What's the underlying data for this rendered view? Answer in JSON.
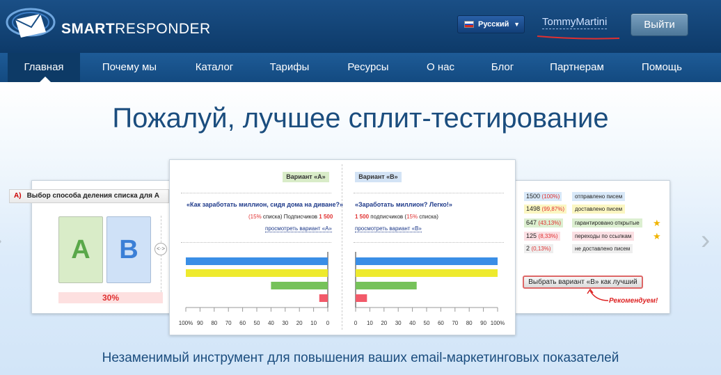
{
  "brand": {
    "logo_bold": "SMART",
    "logo_rest": "RESPONDER"
  },
  "header": {
    "language": "Русский",
    "language_flag": "flag-russia-icon",
    "username": "TommyMartini",
    "logout_label": "Выйти"
  },
  "nav": {
    "items": [
      {
        "label": "Главная"
      },
      {
        "label": "Почему мы"
      },
      {
        "label": "Каталог"
      },
      {
        "label": "Тарифы"
      },
      {
        "label": "Ресурсы"
      },
      {
        "label": "О нас"
      },
      {
        "label": "Блог"
      },
      {
        "label": "Партнерам"
      },
      {
        "label": "Помощь"
      }
    ]
  },
  "hero": {
    "title": "Пожалуй, лучшее сплит-тестирование",
    "subtitle": "Незаменимый инструмент для повышения ваших email-маркетинговых показателей"
  },
  "left_panel": {
    "marker": "A)",
    "heading": "Выбор способа деления списка для А",
    "box_a": "A",
    "box_b": "B",
    "swap": "<·>",
    "percent": "30%"
  },
  "center_panel": {
    "variant_a": "Вариант «А»",
    "variant_b": "Вариант «В»",
    "subject_a": "«Как заработать миллион, сидя дома на диване?»",
    "subject_b": "«Заработать миллион? Легко!»",
    "info_a_pct": "(15%",
    "info_a_mid": " списка) Подписчиков ",
    "info_a_num": "1 500",
    "info_b_num": "1 500",
    "info_b_mid": " подписчиков (",
    "info_b_pct": "15%",
    "info_b_end": " списка)",
    "link_a": "просмотреть вариант «А»",
    "link_b": "просмотреть вариант «В»"
  },
  "chart_data": {
    "type": "bar",
    "orientation": "horizontal",
    "colors": [
      "#3a8ee6",
      "#eeea2e",
      "#76c25a",
      "#f25a6a"
    ],
    "series": [
      {
        "values": [
          100,
          100,
          40,
          6
        ]
      },
      {
        "values": [
          100,
          100,
          43,
          8
        ]
      }
    ],
    "axis_a_ticks": [
      "100%",
      "90",
      "80",
      "70",
      "60",
      "50",
      "40",
      "30",
      "20",
      "10",
      "0"
    ],
    "axis_b_ticks": [
      "0",
      "10",
      "20",
      "30",
      "40",
      "50",
      "60",
      "70",
      "80",
      "90",
      "100%"
    ],
    "xlim": [
      0,
      100
    ]
  },
  "right_panel": {
    "stats": [
      {
        "count": "1500",
        "pct": "(100%)",
        "label": "отправлено писем",
        "color": "#d8e8f8",
        "star": false
      },
      {
        "count": "1498",
        "pct": "(99,87%)",
        "label": "доставлено писем",
        "color": "#fbf6c2",
        "star": false
      },
      {
        "count": "647",
        "pct": "(43,13%)",
        "label": "гарантировано открытые",
        "color": "#dcefd0",
        "star": true
      },
      {
        "count": "125",
        "pct": "(8,33%)",
        "label": "переходы по ссылкам",
        "color": "#fbdfe3",
        "star": true
      },
      {
        "count": "2",
        "pct": "(0,13%)",
        "label": "не доставлено писем",
        "color": "#eeeeee",
        "star": false
      }
    ],
    "choose_button": "Выбрать вариант «В» как лучший",
    "recommend": "Рекомендуем!"
  }
}
